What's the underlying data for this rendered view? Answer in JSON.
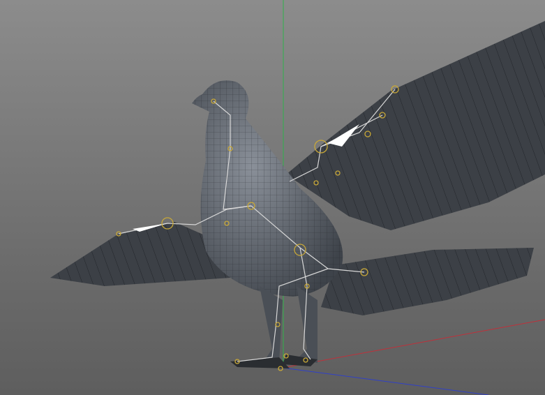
{
  "viewport": {
    "background_top": "#8c8c8c",
    "background_bottom": "#5e5e5e",
    "axis_x_color": "#c0303a",
    "axis_y_color": "#2fb24a",
    "axis_z_color": "#3040c8",
    "mesh_color": "#3c4046",
    "body_color": "#5a5f66",
    "wire_color": "#15181c",
    "bone_color": "#d8d8d8",
    "joint_color": "#c8a838"
  }
}
